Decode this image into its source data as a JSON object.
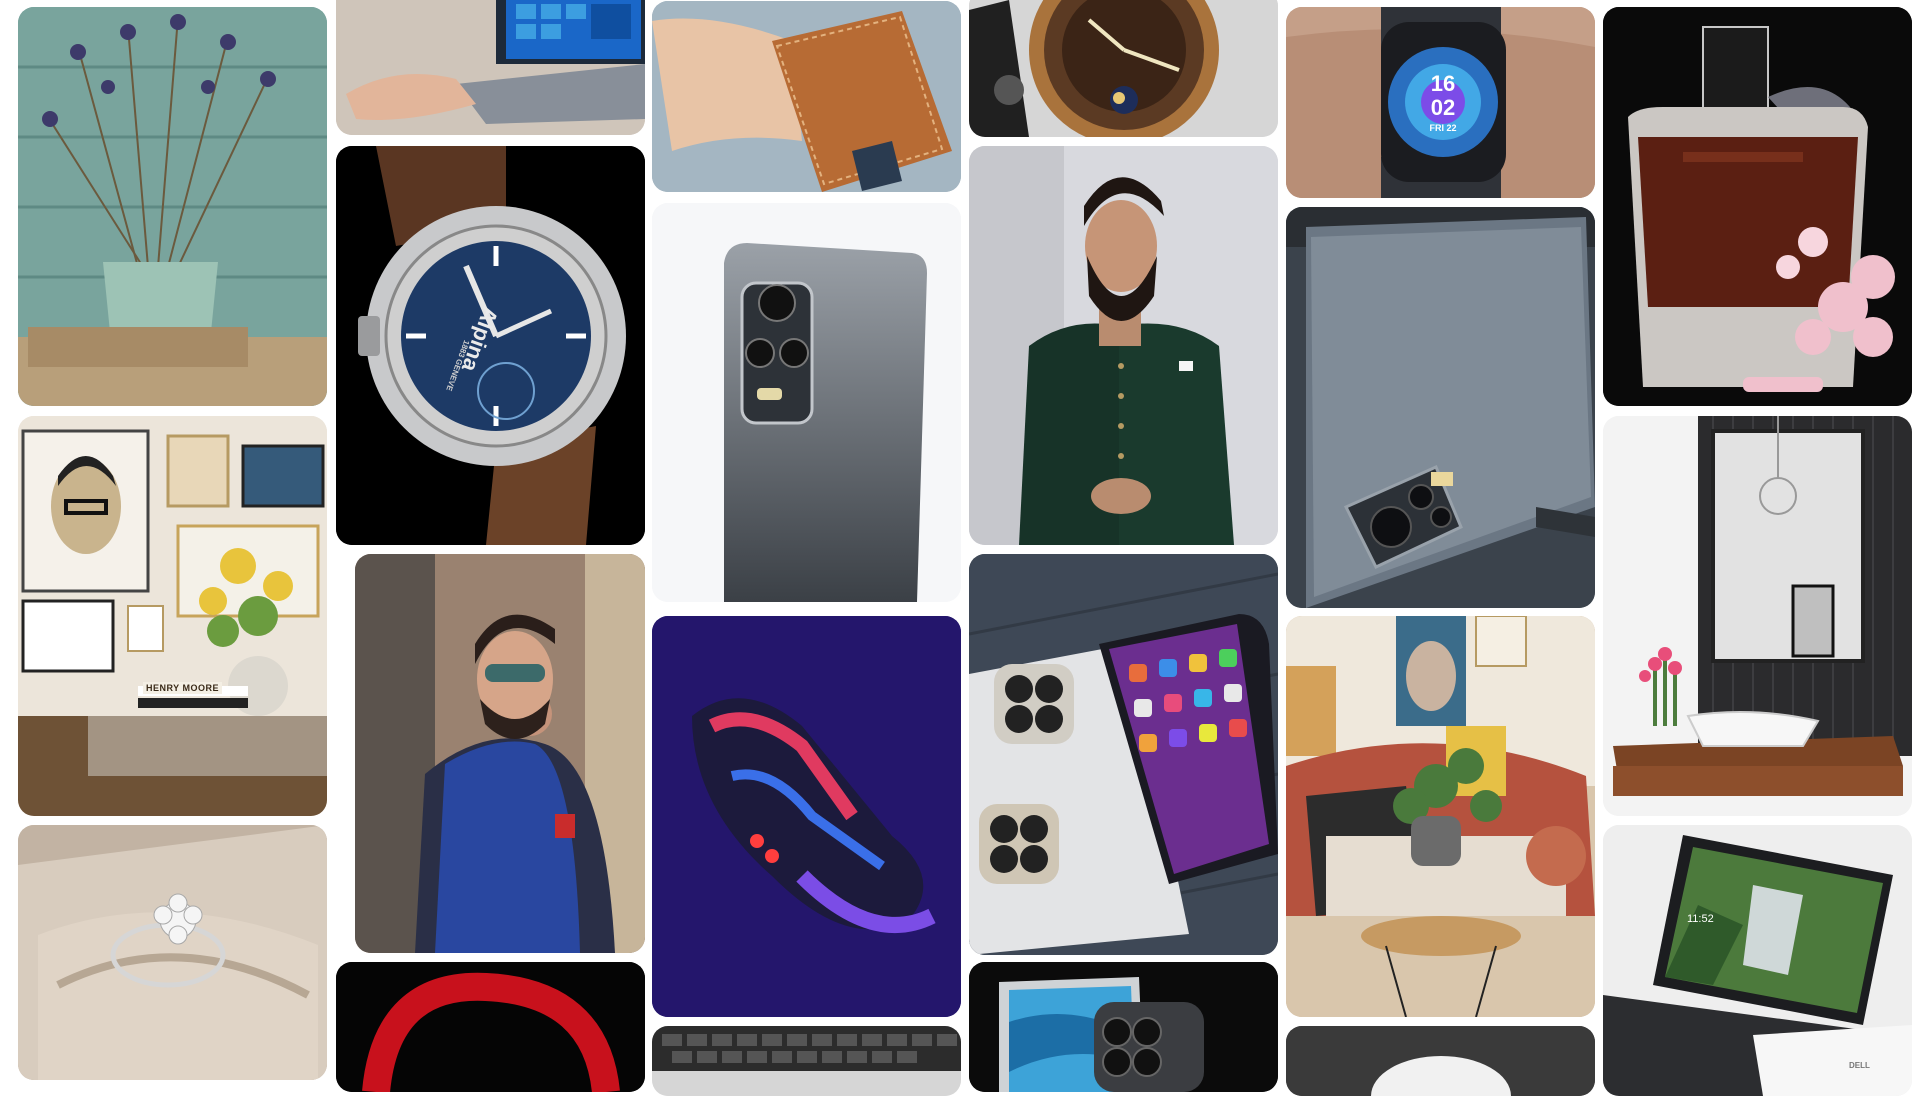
{
  "app": {
    "type": "image masonry grid"
  },
  "tiles": [
    {
      "id": "lavender-pot",
      "bg": "#6f9c95"
    },
    {
      "id": "gallery-living-room",
      "bg": "#e9e2d6",
      "book_label": "HENRY MOORE"
    },
    {
      "id": "diamond-ring",
      "bg": "#cdbfaf"
    },
    {
      "id": "laptop-windows",
      "bg": "#c9bfb5"
    },
    {
      "id": "alpina-watch",
      "bg": "#000000",
      "brand_text": "Alpina",
      "sub_text": "1883 GENEVE"
    },
    {
      "id": "man-blue-vest",
      "bg": "#8e7a68"
    },
    {
      "id": "red-headphones",
      "bg": "#050505"
    },
    {
      "id": "leather-wallet",
      "bg": "#8fa5b4"
    },
    {
      "id": "grey-phone",
      "bg": "#f3f4f6"
    },
    {
      "id": "sneaker",
      "bg": "#25186e"
    },
    {
      "id": "keyboard",
      "bg": "#e6e6e6"
    },
    {
      "id": "gold-watch",
      "bg": "#d9d9d9"
    },
    {
      "id": "man-green-suit",
      "bg": "#d6d7dc"
    },
    {
      "id": "iphones",
      "bg": "#3f4a58"
    },
    {
      "id": "iphone-blue",
      "bg": "#0b0b0b"
    },
    {
      "id": "smartwatch",
      "bg": "#b7917b",
      "time_hour": "16",
      "time_min": "02",
      "date": "FRI 22"
    },
    {
      "id": "vivo-phone",
      "bg": "#4e5964"
    },
    {
      "id": "boho-living-room",
      "bg": "#cdb08f"
    },
    {
      "id": "white-mouse",
      "bg": "#3a3a3a"
    },
    {
      "id": "perfume",
      "bg": "#0b0b0b"
    },
    {
      "id": "bathroom",
      "bg": "#ededed"
    },
    {
      "id": "dell-laptop",
      "bg": "#eeeeee",
      "screen_time": "11:52",
      "logo": "DELL"
    }
  ]
}
